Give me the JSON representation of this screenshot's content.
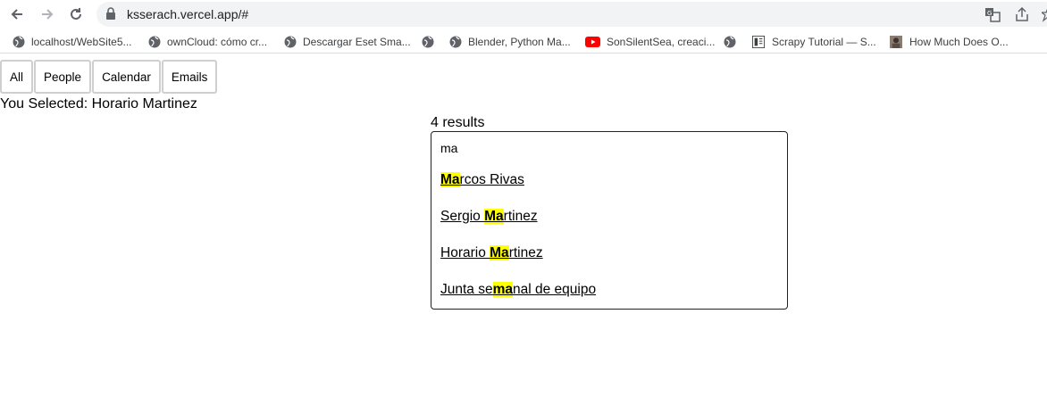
{
  "browser": {
    "url": "ksserach.vercel.app/#",
    "bookmarks": [
      {
        "label": "localhost/WebSite5...",
        "icon": "globe-icon"
      },
      {
        "label": "ownCloud: cómo cr...",
        "icon": "globe-icon"
      },
      {
        "label": "Descargar Eset Sma...",
        "icon": "globe-icon"
      },
      {
        "label": "",
        "icon": "globe-icon"
      },
      {
        "label": "Blender, Python Ma...",
        "icon": "globe-icon"
      },
      {
        "label": "SonSilentSea, creaci...",
        "icon": "youtube-icon"
      },
      {
        "label": "",
        "icon": "globe-icon"
      },
      {
        "label": "Scrapy Tutorial — S...",
        "icon": "document-icon"
      },
      {
        "label": "How Much Does O...",
        "icon": "photo-icon"
      }
    ],
    "colors": {
      "youtube": "#ff0000",
      "omnibox": "#f1f3f4"
    }
  },
  "tabs": [
    "All",
    "People",
    "Calendar",
    "Emails"
  ],
  "selection": {
    "prefix": "You Selected: ",
    "value": "Horario Martinez"
  },
  "results": {
    "count_text": "4 results",
    "query": "ma",
    "items": [
      {
        "before": "",
        "match": "Ma",
        "after": "rcos Rivas"
      },
      {
        "before": "Sergio ",
        "match": "Ma",
        "after": "rtinez"
      },
      {
        "before": "Horario ",
        "match": "Ma",
        "after": "rtinez"
      },
      {
        "before": "Junta se",
        "match": "ma",
        "after": "nal de equipo"
      }
    ],
    "highlight_color": "#ffff00"
  }
}
